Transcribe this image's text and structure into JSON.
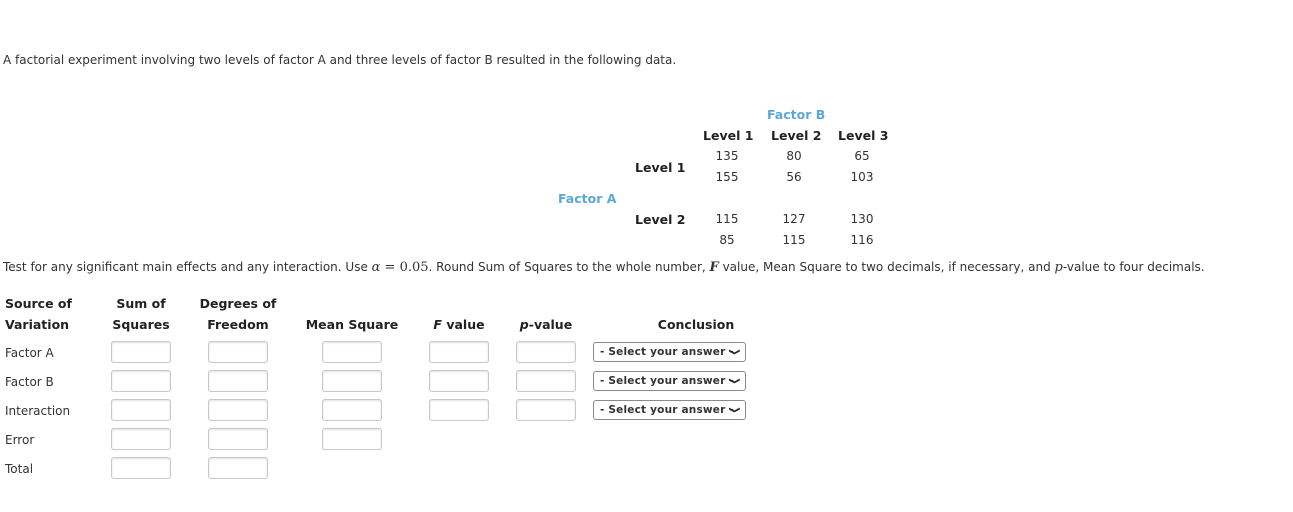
{
  "intro": "A factorial experiment involving two levels of factor A and three levels of factor B resulted in the following data.",
  "data_table": {
    "factor_b_label": "Factor B",
    "factor_a_label": "Factor A",
    "col_headers": [
      "Level 1",
      "Level 2",
      "Level 3"
    ],
    "rows": [
      {
        "label": "Level 1",
        "values": [
          [
            "135",
            "80",
            "65"
          ],
          [
            "155",
            "56",
            "103"
          ]
        ]
      },
      {
        "label": "Level 2",
        "values": [
          [
            "115",
            "127",
            "130"
          ],
          [
            "85",
            "115",
            "116"
          ]
        ]
      }
    ]
  },
  "instructions": {
    "part1": "Test for any significant main effects and any interaction. Use ",
    "alpha_symbol": "α",
    "equals": " = ",
    "alpha_value": "0.05",
    "part2": ". Round Sum of Squares to the whole number, ",
    "f_symbol": "F",
    "part3": " value, Mean Square to two decimals, if necessary, and ",
    "p_symbol": "p",
    "part4": "-value to four decimals."
  },
  "anova": {
    "headers": {
      "source_line1": "Source of",
      "source_line2": "Variation",
      "ss_line1": "Sum of",
      "ss_line2": "Squares",
      "df_line1": "Degrees of",
      "df_line2": "Freedom",
      "ms": "Mean Square",
      "f_italic": "F",
      "f_rest": " value",
      "p_italic": "p",
      "p_rest": "-value",
      "conclusion": "Conclusion"
    },
    "rows": [
      "Factor A",
      "Factor B",
      "Interaction",
      "Error",
      "Total"
    ],
    "select_placeholder": "- Select your answer -"
  }
}
